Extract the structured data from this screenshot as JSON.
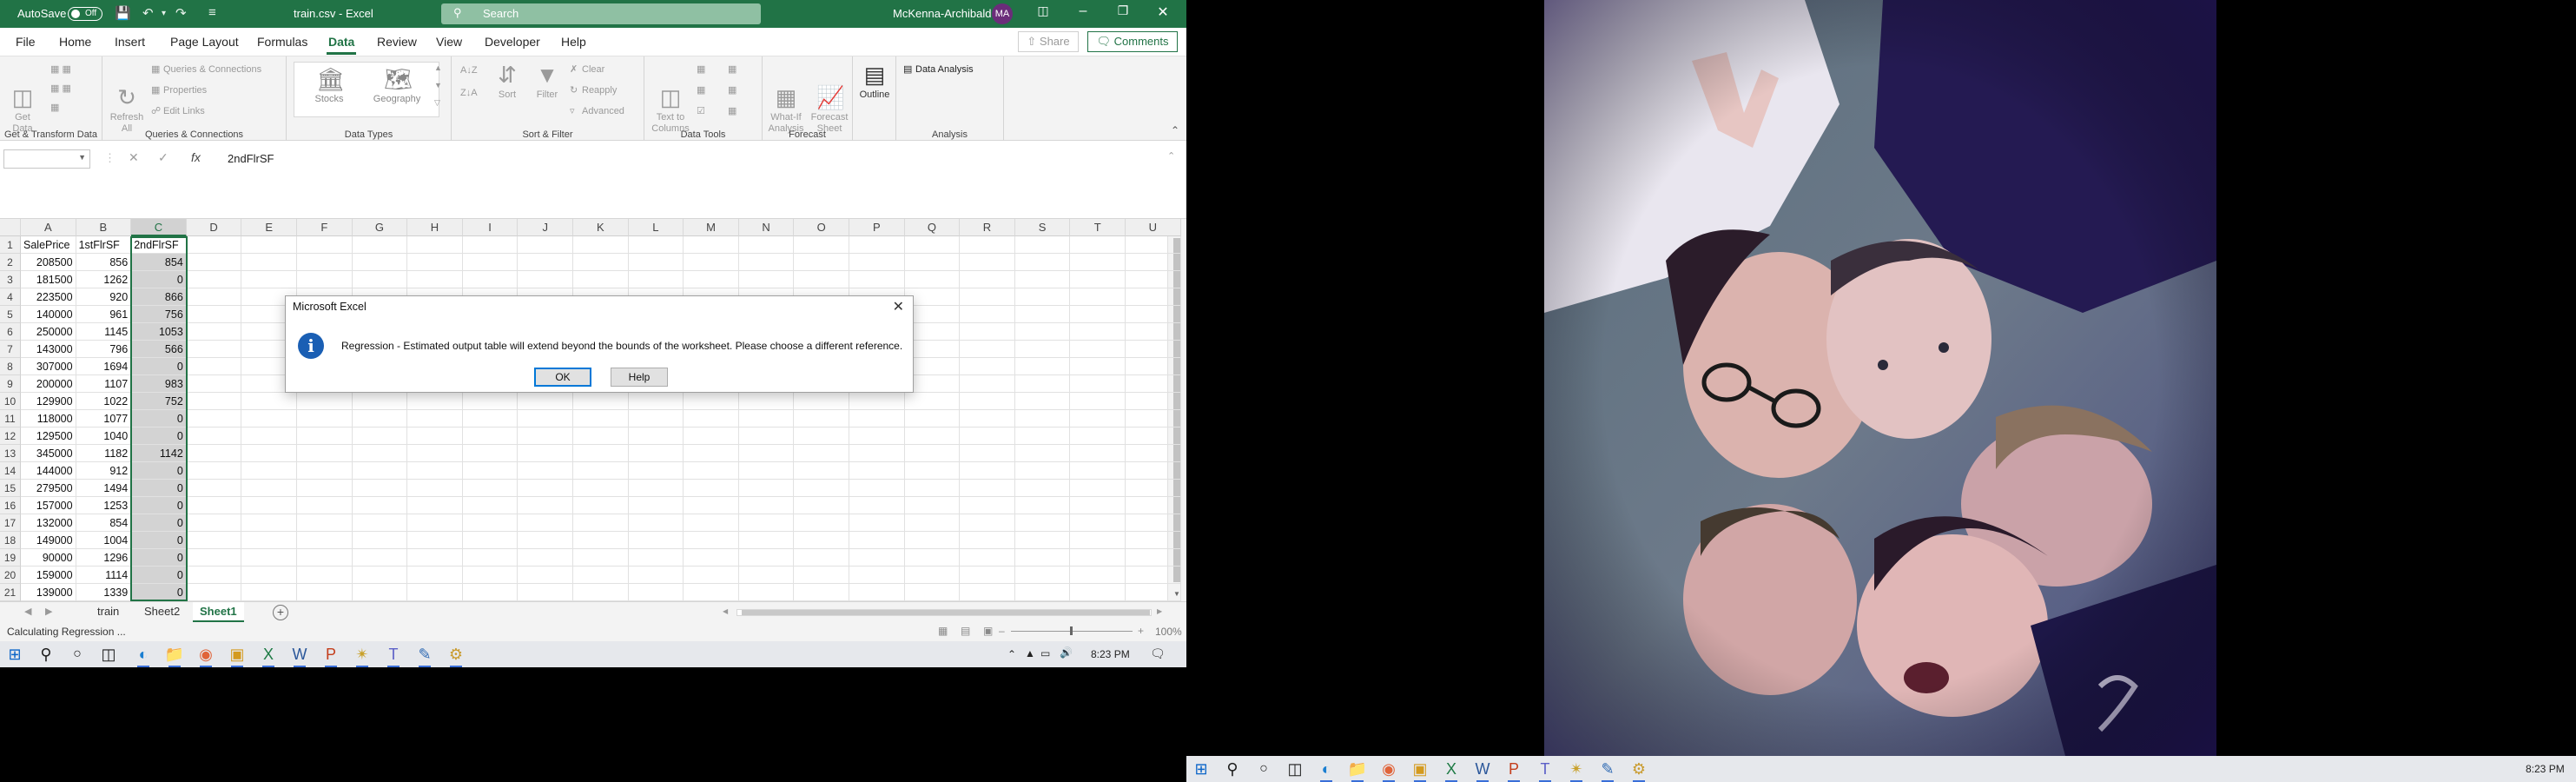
{
  "excel": {
    "titlebar": {
      "autosave_label": "AutoSave",
      "autosave_state": "Off",
      "doc_title": "train.csv  -  Excel",
      "search_placeholder": "Search",
      "user_name": "McKenna-Archibald",
      "user_initials": "MA"
    },
    "tabs": [
      "File",
      "Home",
      "Insert",
      "Page Layout",
      "Formulas",
      "Data",
      "Review",
      "View",
      "Developer",
      "Help"
    ],
    "active_tab": "Data",
    "share_label": "Share",
    "comments_label": "Comments",
    "ribbon": {
      "get_transform": {
        "get_data": "Get\nData",
        "label": "Get & Transform Data"
      },
      "queries": {
        "refresh_all": "Refresh\nAll",
        "queries_connections": "Queries & Connections",
        "properties": "Properties",
        "edit_links": "Edit Links",
        "label": "Queries & Connections"
      },
      "data_types": {
        "stocks": "Stocks",
        "geography": "Geography",
        "label": "Data Types"
      },
      "sort_filter": {
        "sort": "Sort",
        "filter": "Filter",
        "clear": "Clear",
        "reapply": "Reapply",
        "advanced": "Advanced",
        "label": "Sort & Filter"
      },
      "data_tools": {
        "text_to_columns": "Text to\nColumns",
        "label": "Data Tools"
      },
      "forecast": {
        "what_if": "What-If\nAnalysis",
        "forecast_sheet": "Forecast\nSheet",
        "label": "Forecast"
      },
      "outline": {
        "outline": "Outline"
      },
      "analysis": {
        "data_analysis": "Data Analysis",
        "label": "Analysis"
      }
    },
    "formula_bar": {
      "name_box": "",
      "fx": "fx",
      "content": "2ndFlrSF"
    },
    "columns": [
      "A",
      "B",
      "C",
      "D",
      "E",
      "F",
      "G",
      "H",
      "I",
      "J",
      "K",
      "L",
      "M",
      "N",
      "O",
      "P",
      "Q",
      "R",
      "S",
      "T",
      "U"
    ],
    "selected_column": "C",
    "headers": [
      "SalePrice",
      "1stFlrSF",
      "2ndFlrSF"
    ],
    "rows": [
      [
        "208500",
        "856",
        "854"
      ],
      [
        "181500",
        "1262",
        "0"
      ],
      [
        "223500",
        "920",
        "866"
      ],
      [
        "140000",
        "961",
        "756"
      ],
      [
        "250000",
        "1145",
        "1053"
      ],
      [
        "143000",
        "796",
        "566"
      ],
      [
        "307000",
        "1694",
        "0"
      ],
      [
        "200000",
        "1107",
        "983"
      ],
      [
        "129900",
        "1022",
        "752"
      ],
      [
        "118000",
        "1077",
        "0"
      ],
      [
        "129500",
        "1040",
        "0"
      ],
      [
        "345000",
        "1182",
        "1142"
      ],
      [
        "144000",
        "912",
        "0"
      ],
      [
        "279500",
        "1494",
        "0"
      ],
      [
        "157000",
        "1253",
        "0"
      ],
      [
        "132000",
        "854",
        "0"
      ],
      [
        "149000",
        "1004",
        "0"
      ],
      [
        "90000",
        "1296",
        "0"
      ],
      [
        "159000",
        "1114",
        "0"
      ],
      [
        "139000",
        "1339",
        "0"
      ]
    ],
    "sheets": [
      "train",
      "Sheet2",
      "Sheet1"
    ],
    "active_sheet": "Sheet1",
    "status": "Calculating Regression ...",
    "zoom": "100%",
    "dialog": {
      "title": "Microsoft Excel",
      "message": "Regression - Estimated output table will extend beyond the bounds of the worksheet.  Please choose a different reference.",
      "ok": "OK",
      "help": "Help"
    },
    "taskbar_time": "8:23 PM"
  },
  "right_monitor": {
    "taskbar_time": "8:23 PM"
  }
}
